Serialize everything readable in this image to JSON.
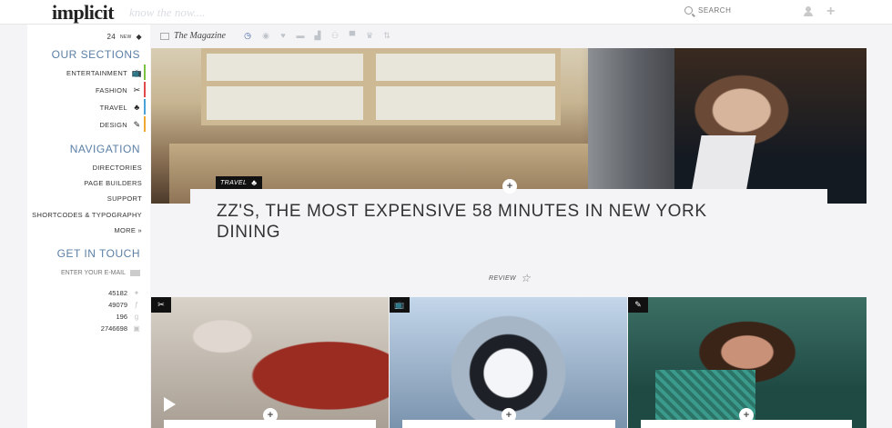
{
  "header": {
    "logo": "implicit",
    "tagline": "know the now....",
    "search_placeholder": "SEARCH"
  },
  "sidebar": {
    "counter": {
      "count": "24",
      "label": "NEW"
    },
    "sections_title": "OUR SECTIONS",
    "sections": [
      {
        "label": "ENTERTAINMENT",
        "icon": "tv-icon",
        "color": "#7cc242"
      },
      {
        "label": "FASHION",
        "icon": "scissors-icon",
        "color": "#e04a4a"
      },
      {
        "label": "TRAVEL",
        "icon": "palm-tree-icon",
        "color": "#4aa3d8"
      },
      {
        "label": "DESIGN",
        "icon": "pen-icon",
        "color": "#f0a830"
      }
    ],
    "navigation_title": "NAVIGATION",
    "navigation": [
      {
        "label": "DIRECTORIES"
      },
      {
        "label": "PAGE BUILDERS"
      },
      {
        "label": "SUPPORT"
      },
      {
        "label": "SHORTCODES & TYPOGRAPHY"
      },
      {
        "label": "MORE »"
      }
    ],
    "contact_title": "GET IN TOUCH",
    "email_placeholder": "ENTER YOUR E-MAIL",
    "social": [
      {
        "count": "45182",
        "icon": "twitter-icon"
      },
      {
        "count": "49079",
        "icon": "facebook-icon"
      },
      {
        "count": "196",
        "icon": "google-plus-icon"
      },
      {
        "count": "2746698",
        "icon": "youtube-icon"
      }
    ]
  },
  "toolbar": {
    "magazine_label": "The Magazine"
  },
  "hero": {
    "category": "TRAVEL",
    "title": "ZZ'S, THE MOST EXPENSIVE 58 MINUTES IN NEW YORK DINING",
    "review_label": "REVIEW"
  },
  "thumbs": [
    {
      "category_icon": "scissors-icon"
    },
    {
      "category_icon": "tv-icon"
    },
    {
      "category_icon": "pen-icon"
    }
  ],
  "colors": {
    "accent": "#5b7fa6",
    "background": "#f4f4f6"
  }
}
